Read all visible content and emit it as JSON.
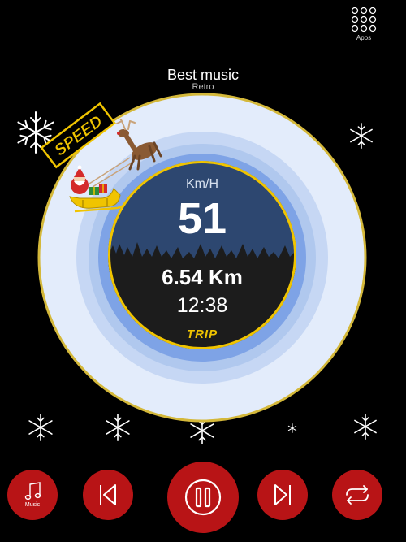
{
  "header": {
    "apps_label": "Apps"
  },
  "track": {
    "title": "Best music",
    "artist": "Retro"
  },
  "badge": {
    "label": "SPEED"
  },
  "speedometer": {
    "unit": "Km/H",
    "speed": "51",
    "distance": "6.54 Km",
    "time": "12:38",
    "mode_label": "TRIP"
  },
  "controls": {
    "music_label": "Music"
  },
  "colors": {
    "accent": "#b81416",
    "gold": "#f0c400",
    "sky": "#2d4770",
    "ring_outer": "#e3ecfb",
    "ring_mid": "#b0c8ee",
    "ring_inner": "#7ea3e6"
  },
  "icons": [
    "apps-grid-icon",
    "snowflake-icon",
    "santa-sleigh-icon",
    "music-note-icon",
    "skip-previous-icon",
    "pause-icon",
    "skip-next-icon",
    "repeat-icon"
  ]
}
